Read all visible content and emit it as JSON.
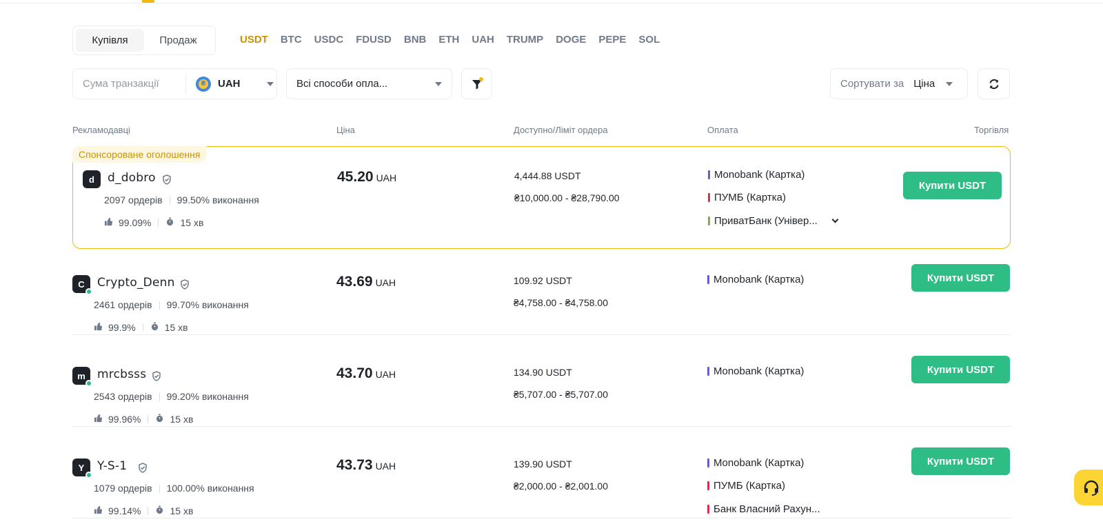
{
  "toggle": {
    "buy": "Купівля",
    "sell": "Продаж"
  },
  "crypto_tabs": [
    "USDT",
    "BTC",
    "USDC",
    "FDUSD",
    "BNB",
    "ETH",
    "UAH",
    "TRUMP",
    "DOGE",
    "PEPE",
    "SOL"
  ],
  "filters": {
    "amount_placeholder": "Сума транзакції",
    "currency": "UAH",
    "payment": "Всі способи опла...",
    "sort_label": "Сортувати за",
    "sort_value": "Ціна"
  },
  "columns": {
    "advertisers": "Рекламодавці",
    "price": "Ціна",
    "available": "Доступно/Ліміт ордера",
    "payment": "Оплата",
    "trade": "Торгівля"
  },
  "sponsored_label": "Спонсороване оголошення",
  "ads": [
    {
      "initial": "d",
      "online": false,
      "nick": "d_dobro",
      "orders": "2097 ордерів",
      "completion": "99.50% виконання",
      "rating": "99.09%",
      "time": "15 хв",
      "price": "45.20",
      "unit": "UAH",
      "available": "4,444.88 USDT",
      "limit": "₴10,000.00 - ₴28,790.00",
      "payments": [
        {
          "name": "Monobank (Картка)",
          "color": "#6a5acd"
        },
        {
          "name": "ПУМБ (Картка)",
          "color": "#d9304f"
        },
        {
          "name": "ПриватБанк (Універ...",
          "color": "#7cb342"
        }
      ],
      "button": "Купити USDT"
    },
    {
      "initial": "C",
      "online": true,
      "nick": "Crypto_Denn",
      "orders": "2461 ордерів",
      "completion": "99.70% виконання",
      "rating": "99.9%",
      "time": "15 хв",
      "price": "43.69",
      "unit": "UAH",
      "available": "109.92 USDT",
      "limit": "₴4,758.00 - ₴4,758.00",
      "payments": [
        {
          "name": "Monobank (Картка)",
          "color": "#6a5acd"
        }
      ],
      "button": "Купити USDT"
    },
    {
      "initial": "m",
      "online": true,
      "nick": "mrcbsss",
      "orders": "2543 ордерів",
      "completion": "99.20% виконання",
      "rating": "99.96%",
      "time": "15 хв",
      "price": "43.70",
      "unit": "UAH",
      "available": "134.90 USDT",
      "limit": "₴5,707.00 - ₴5,707.00",
      "payments": [
        {
          "name": "Monobank (Картка)",
          "color": "#6a5acd"
        }
      ],
      "button": "Купити USDT"
    },
    {
      "initial": "Y",
      "online": true,
      "nick": "Y-S-1",
      "orders": "1079 ордерів",
      "completion": "100.00% виконання",
      "rating": "99.14%",
      "time": "15 хв",
      "price": "43.73",
      "unit": "UAH",
      "available": "139.90 USDT",
      "limit": "₴2,000.00 - ₴2,001.00",
      "payments": [
        {
          "name": "Monobank (Картка)",
          "color": "#6a5acd"
        },
        {
          "name": "ПУМБ (Картка)",
          "color": "#d9304f"
        },
        {
          "name": "Банк Власний Рахун...",
          "color": "#d9304f"
        }
      ],
      "button": "Купити USDT"
    }
  ],
  "icons": {
    "filter": "filter-icon",
    "refresh": "refresh-icon",
    "caret": "caret-down-icon",
    "badge": "verified-badge-icon",
    "thumb": "thumbs-up-icon",
    "timer": "timer-icon",
    "support": "headset-icon"
  },
  "colors": {
    "accent": "#f0b90b",
    "buy": "#2ebd85",
    "text": "#1e2329",
    "muted": "#707a8a"
  }
}
